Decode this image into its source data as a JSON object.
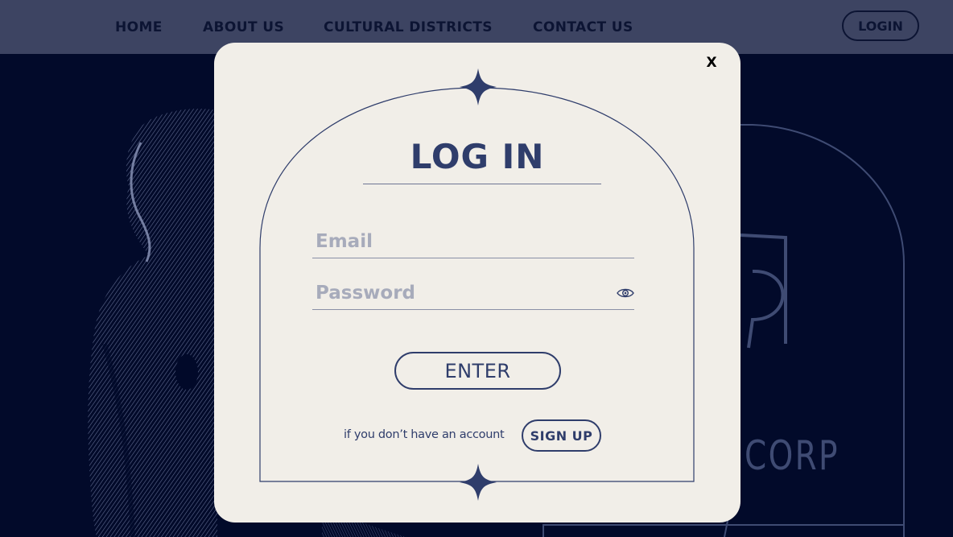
{
  "nav": {
    "items": [
      {
        "label": "HOME"
      },
      {
        "label": "ABOUT US"
      },
      {
        "label": "CULTURAL DISTRICTS"
      },
      {
        "label": "CONTACT US"
      }
    ],
    "login_label": "LOGIN"
  },
  "hero": {
    "brand_partial": "CORP"
  },
  "modal": {
    "close_label": "X",
    "title": "LOG IN",
    "email_placeholder": "Email",
    "email_value": "",
    "password_placeholder": "Password",
    "password_value": "",
    "enter_label": "ENTER",
    "signup_prompt": "if you don’t have  an account",
    "signup_label": "SIGN UP"
  },
  "colors": {
    "background": "#020a2a",
    "navbar": "#3d4462",
    "modal": "#f1eee8",
    "accent": "#2f3d6b"
  },
  "icons": {
    "password_toggle": "eye-icon",
    "sparkle": "four-point-star-icon"
  }
}
